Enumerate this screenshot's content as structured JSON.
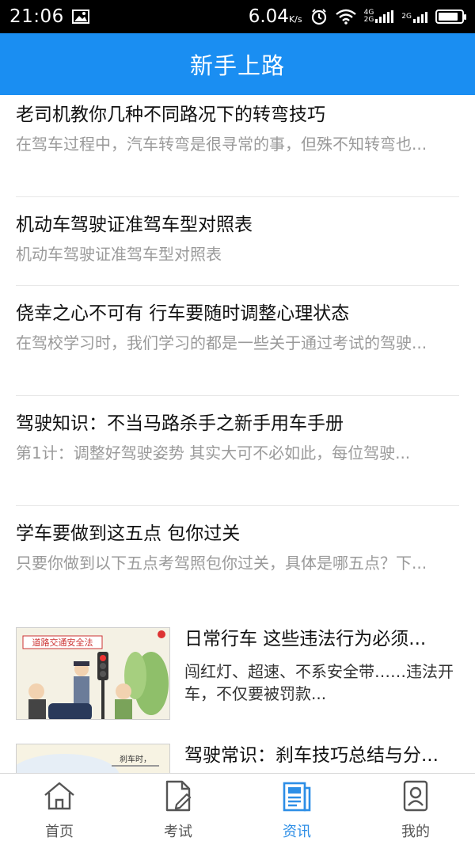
{
  "status_bar": {
    "time": "21:06",
    "net_speed": "6.04",
    "net_speed_unit": "K/s",
    "sig1": "4G",
    "sig2": "2G",
    "sig3": "2G"
  },
  "header": {
    "title": "新手上路"
  },
  "articles": [
    {
      "title": "老司机教你几种不同路况下的转弯技巧",
      "summary": "在驾车过程中，汽车转弯是很寻常的事，但殊不知转弯也..."
    },
    {
      "title": "机动车驾驶证准驾车型对照表",
      "summary": "机动车驾驶证准驾车型对照表"
    },
    {
      "title": "侥幸之心不可有 行车要随时调整心理状态",
      "summary": "在驾校学习时，我们学习的都是一些关于通过考试的驾驶..."
    },
    {
      "title": "驾驶知识：不当马路杀手之新手用车手册",
      "summary": "第1计：调整好驾驶姿势 其实大可不必如此，每位驾驶..."
    },
    {
      "title": "学车要做到这五点 包你过关",
      "summary": "只要你做到以下五点考驾照包你过关，具体是哪五点？下..."
    }
  ],
  "image_articles": [
    {
      "title": "日常行车 这些违法行为必须...",
      "summary": "闯红灯、超速、不系安全带……违法开车，不仅要被罚款...",
      "image_caption": "道路交通安全法"
    },
    {
      "title": "驾驶常识：刹车技巧总结与分...",
      "summary": "",
      "image_caption": "刹车时，"
    }
  ],
  "tabs": [
    {
      "label": "首页",
      "icon": "home-icon"
    },
    {
      "label": "考试",
      "icon": "exam-icon"
    },
    {
      "label": "资讯",
      "icon": "news-icon",
      "active": true
    },
    {
      "label": "我的",
      "icon": "profile-icon"
    }
  ],
  "colors": {
    "primary": "#1a8ef2",
    "tab_active": "#2d8ee6",
    "summary_gray": "#9a9a9a"
  }
}
